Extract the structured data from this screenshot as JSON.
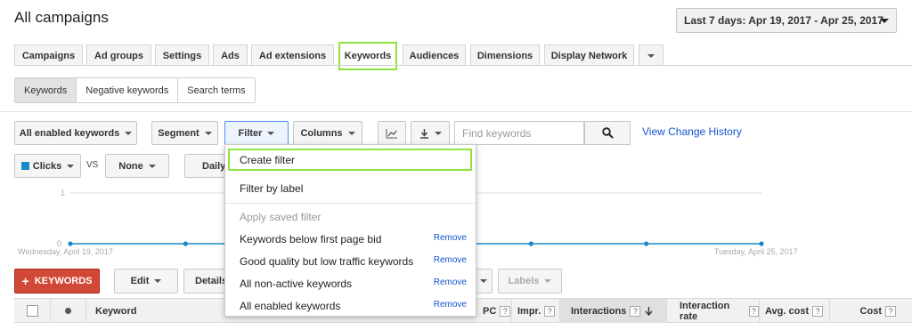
{
  "header": {
    "title": "All campaigns",
    "date_range": "Last 7 days: Apr 19, 2017 - Apr 25, 2017"
  },
  "tabs": [
    "Campaigns",
    "Ad groups",
    "Settings",
    "Ads",
    "Ad extensions",
    "Keywords",
    "Audiences",
    "Dimensions",
    "Display Network"
  ],
  "active_tab": "Keywords",
  "subtabs": [
    "Keywords",
    "Negative keywords",
    "Search terms"
  ],
  "toolbar": {
    "status_filter": "All enabled keywords",
    "segment": "Segment",
    "filter": "Filter",
    "columns": "Columns",
    "search_placeholder": "Find keywords",
    "change_history": "View Change History"
  },
  "chart_controls": {
    "metric1": "Clicks",
    "vs": "VS",
    "metric2": "None",
    "period": "Daily"
  },
  "chart_data": {
    "type": "line",
    "x": [
      "Wednesday, April 19, 2017",
      "",
      "",
      "",
      "",
      "",
      "Tuesday, April 25, 2017"
    ],
    "series": [
      {
        "values": [
          0,
          0,
          0,
          0,
          0,
          0,
          0
        ]
      }
    ],
    "ylim": [
      0,
      1
    ],
    "yticks": [
      "0",
      "1"
    ],
    "x_start_label": "Wednesday, April 19, 2017",
    "x_end_label": "Tuesday, April 25, 2017"
  },
  "filter_menu": {
    "create": "Create filter",
    "by_label": "Filter by label",
    "saved_header": "Apply saved filter",
    "saved": [
      {
        "label": "Keywords below first page bid",
        "action": "Remove"
      },
      {
        "label": "Good quality but low traffic keywords",
        "action": "Remove"
      },
      {
        "label": "All non-active keywords",
        "action": "Remove"
      },
      {
        "label": "All enabled keywords",
        "action": "Remove"
      }
    ]
  },
  "actions": {
    "add_keywords": "KEYWORDS",
    "edit": "Edit",
    "details": "Details",
    "labels": "Labels"
  },
  "table_headers": {
    "keyword": "Keyword",
    "cpc": "PC",
    "impr": "Impr.",
    "interactions": "Interactions",
    "interaction_rate": "Interaction rate",
    "avg_cost": "Avg. cost",
    "cost": "Cost",
    "help": "?"
  },
  "colors": {
    "highlight": "#8fe33e",
    "series": "#1a8ac6",
    "add_button": "#d14836",
    "link": "#1155cc"
  }
}
